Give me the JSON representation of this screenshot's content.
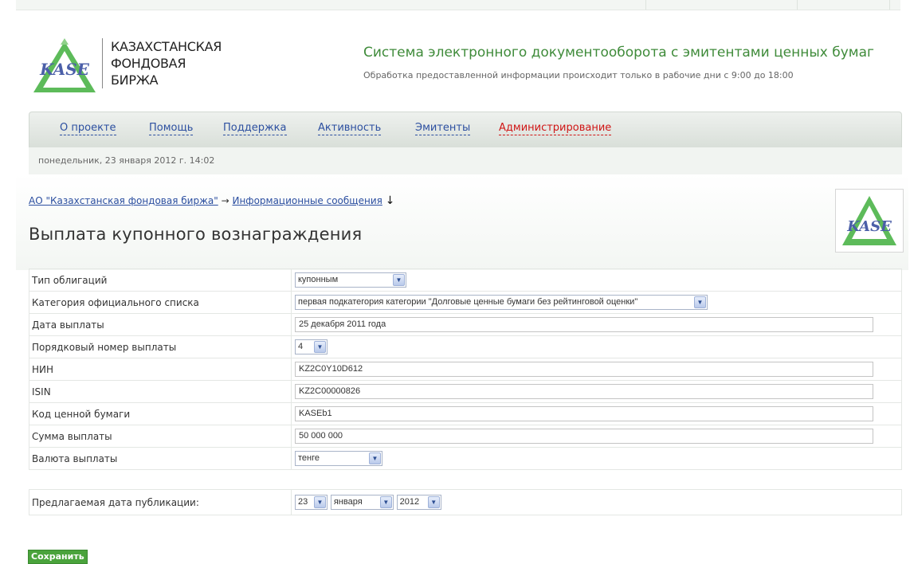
{
  "header": {
    "logo_alt": "KASE",
    "exchange_name": [
      "КАЗАХСТАНСКАЯ",
      "ФОНДОВАЯ",
      "БИРЖА"
    ],
    "site_title": "Система электронного документооборота с эмитентами ценных бумаг",
    "site_note": "Обработка предоставленной информации происходит только в рабочие дни с 9:00 до 18:00"
  },
  "nav": {
    "items": [
      "О проекте",
      "Помощь",
      "Поддержка",
      "Активность",
      "Эмитенты",
      "Администрирование"
    ]
  },
  "date_text": "понедельник, 23 января 2012 г. 14:02",
  "breadcrumb": {
    "root": "АО \"Казахстанская фондовая биржа\"",
    "arrow": "→",
    "current": "Информационные сообщения",
    "down_arrow": "↓"
  },
  "page_title": "Выплата купонного вознаграждения",
  "form": {
    "bond_type": {
      "label": "Тип облигаций",
      "value": "купонным"
    },
    "list_category": {
      "label": "Категория официального списка",
      "value": "первая подкатегория категории \"Долговые ценные бумаги без рейтинговой оценки\""
    },
    "payment_date": {
      "label": "Дата выплаты",
      "value": "25 декабря 2011 года"
    },
    "payment_number": {
      "label": "Порядковый номер выплаты",
      "value": "4"
    },
    "nin": {
      "label": "НИН",
      "value": "KZ2C0Y10D612"
    },
    "isin": {
      "label": "ISIN",
      "value": "KZ2C00000826"
    },
    "security_code": {
      "label": "Код ценной бумаги",
      "value": "KASEb1"
    },
    "amount": {
      "label": "Сумма выплаты",
      "value": "50 000 000"
    },
    "currency": {
      "label": "Валюта выплаты",
      "value": "тенге"
    },
    "publication_date": {
      "label": "Предлагаемая дата публикации:",
      "day": "23",
      "month": "января",
      "year": "2012"
    }
  },
  "save_label": "Сохранить",
  "colors": {
    "accent_green": "#3f8b3a",
    "link_blue": "#2c4fa0",
    "admin_red": "#d01515",
    "button_green": "#4aa33c"
  }
}
